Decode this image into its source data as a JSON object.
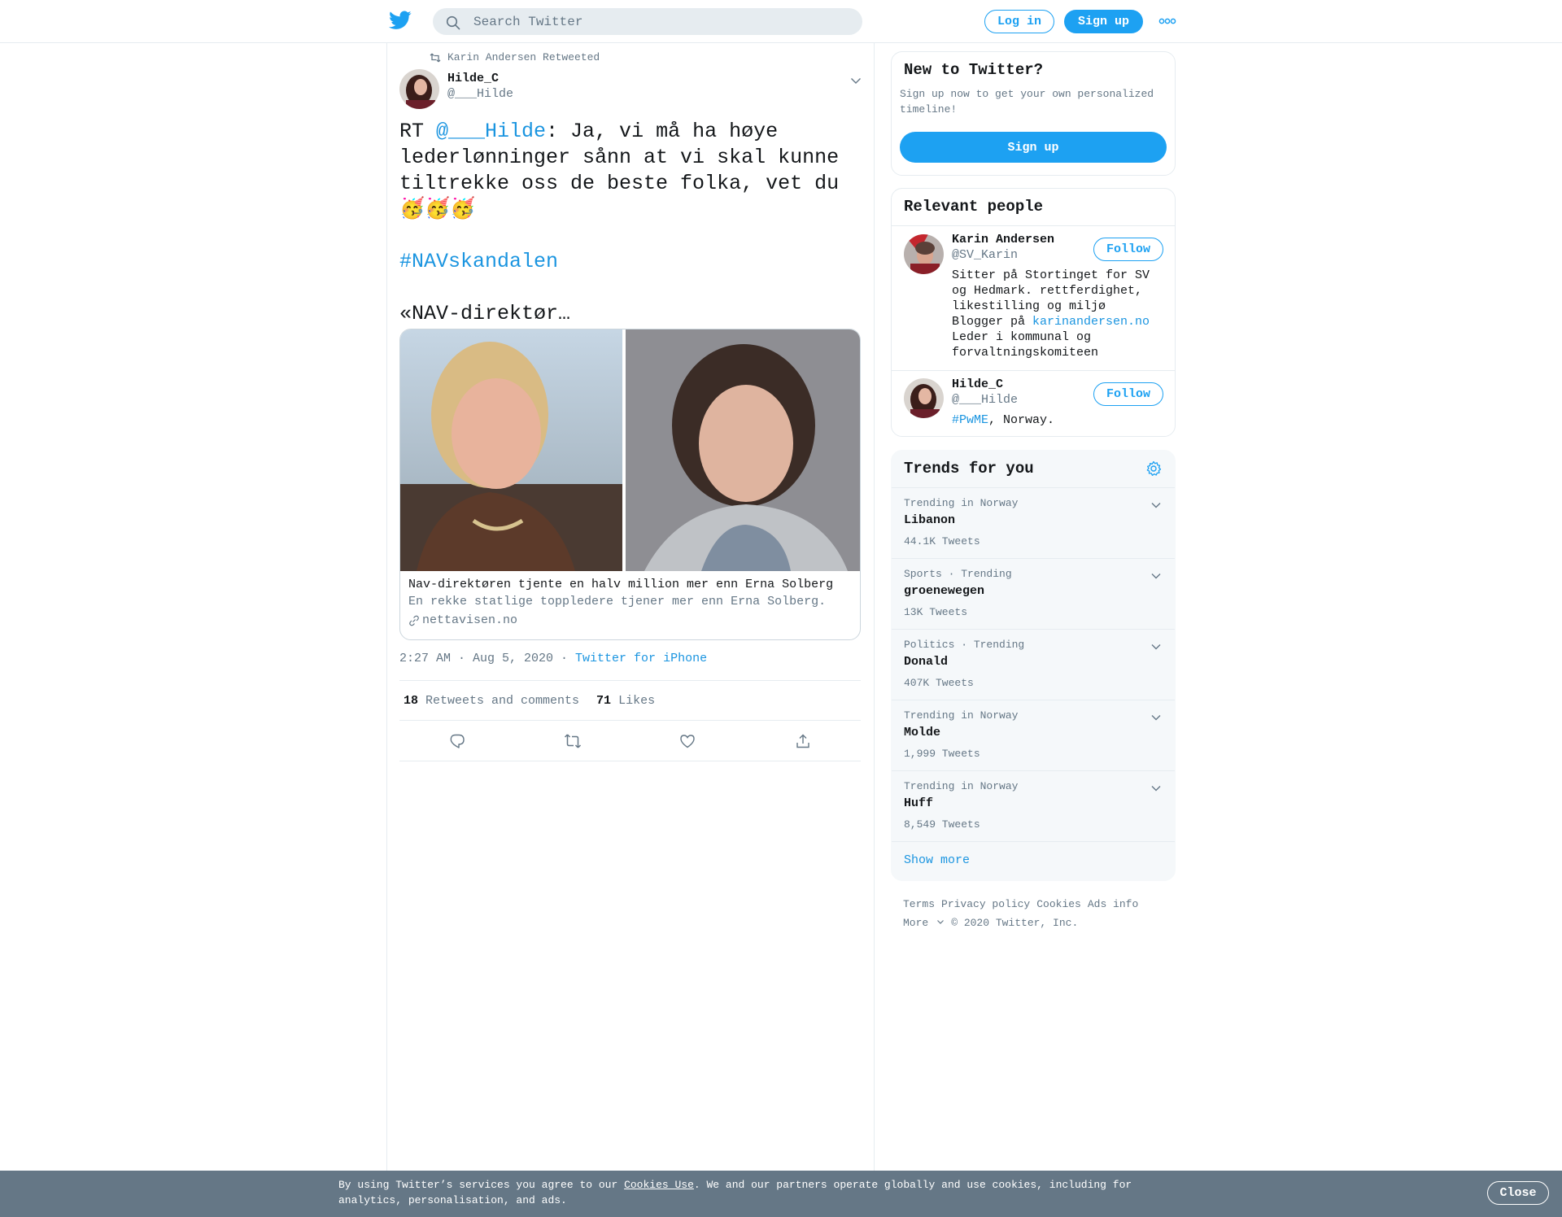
{
  "header": {
    "logo_icon": "twitter-bird-icon",
    "search_placeholder": "Search Twitter",
    "login_label": "Log in",
    "signup_label": "Sign up",
    "more_icon": "more-dots-icon"
  },
  "tweet": {
    "retweeted_by": "Karin Andersen Retweeted",
    "author_name": "Hilde_C",
    "author_handle": "@___Hilde",
    "text_prefix": "RT ",
    "text_mention": "@___Hilde",
    "text_body": ": Ja, vi må ha høye lederlønninger sånn at vi skal kunne tiltrekke oss de beste folka, vet du 🥳🥳🥳",
    "hashtag": "#NAVskandalen",
    "text_tail": "«NAV-direktør…",
    "card": {
      "title": "Nav-direktøren tjente en halv million mer enn Erna Solberg",
      "description": "En rekke statlige toppledere tjener mer enn Erna Solberg.",
      "domain": "nettavisen.no"
    },
    "time": "2:27 AM · Aug 5, 2020",
    "meta_sep": " · ",
    "source": "Twitter for iPhone",
    "retweets_count": "18",
    "retweets_label": "Retweets and comments",
    "likes_count": "71",
    "likes_label": "Likes"
  },
  "sidebar": {
    "new_title": "New to Twitter?",
    "new_sub": "Sign up now to get your own personalized timeline!",
    "new_signup": "Sign up",
    "people_title": "Relevant people",
    "people": [
      {
        "name": "Karin Andersen",
        "handle": "@SV_Karin",
        "follow": "Follow",
        "bio_pre": "Sitter på Stortinget for SV og Hedmark. rettferdighet, likestilling og miljø\nBlogger på ",
        "bio_link": "karinandersen.no",
        "bio_post": "\nLeder i kommunal og forvaltningskomiteen"
      },
      {
        "name": "Hilde_C",
        "handle": "@___Hilde",
        "follow": "Follow",
        "bio_link": "#PwME",
        "bio_post": ", Norway."
      }
    ],
    "trends_title": "Trends for you",
    "trends": [
      {
        "context": "Trending in Norway",
        "name": "Libanon",
        "count": "44.1K Tweets"
      },
      {
        "context": "Sports · Trending",
        "name": "groenewegen",
        "count": "13K Tweets"
      },
      {
        "context": "Politics · Trending",
        "name": "Donald",
        "count": "407K Tweets"
      },
      {
        "context": "Trending in Norway",
        "name": "Molde",
        "count": "1,999 Tweets"
      },
      {
        "context": "Trending in Norway",
        "name": "Huff",
        "count": "8,549 Tweets"
      }
    ],
    "show_more": "Show more",
    "footer": {
      "terms": "Terms",
      "privacy": "Privacy policy",
      "cookies": "Cookies",
      "ads": "Ads info",
      "more": "More",
      "copyright": "© 2020 Twitter, Inc."
    }
  },
  "cookie_bar": {
    "text_pre": "By using Twitter’s services you agree to our ",
    "link": "Cookies Use",
    "text_post": ". We and our partners operate globally and use cookies, including for analytics, personalisation, and ads.",
    "close": "Close"
  },
  "colors": {
    "brand": "#1da1f2",
    "link": "#1b95e0",
    "muted": "#657786",
    "cookie_bg": "#657786"
  }
}
